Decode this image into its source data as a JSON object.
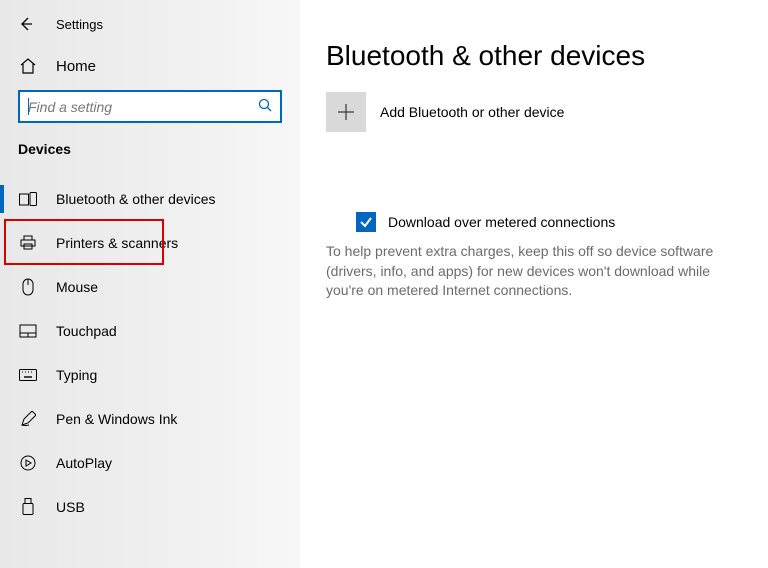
{
  "titlebar": {
    "label": "Settings"
  },
  "home": {
    "label": "Home"
  },
  "search": {
    "placeholder": "Find a setting"
  },
  "section_label": "Devices",
  "nav": {
    "items": [
      {
        "label": "Bluetooth & other devices"
      },
      {
        "label": "Printers & scanners"
      },
      {
        "label": "Mouse"
      },
      {
        "label": "Touchpad"
      },
      {
        "label": "Typing"
      },
      {
        "label": "Pen & Windows Ink"
      },
      {
        "label": "AutoPlay"
      },
      {
        "label": "USB"
      }
    ]
  },
  "main": {
    "title": "Bluetooth & other devices",
    "add_label": "Add Bluetooth or other device",
    "metered_label": "Download over metered connections",
    "metered_desc": "To help prevent extra charges, keep this off so device software (drivers, info, and apps) for new devices won't download while you're on metered Internet connections."
  },
  "colors": {
    "accent": "#0067c0",
    "highlight": "#d60000"
  }
}
